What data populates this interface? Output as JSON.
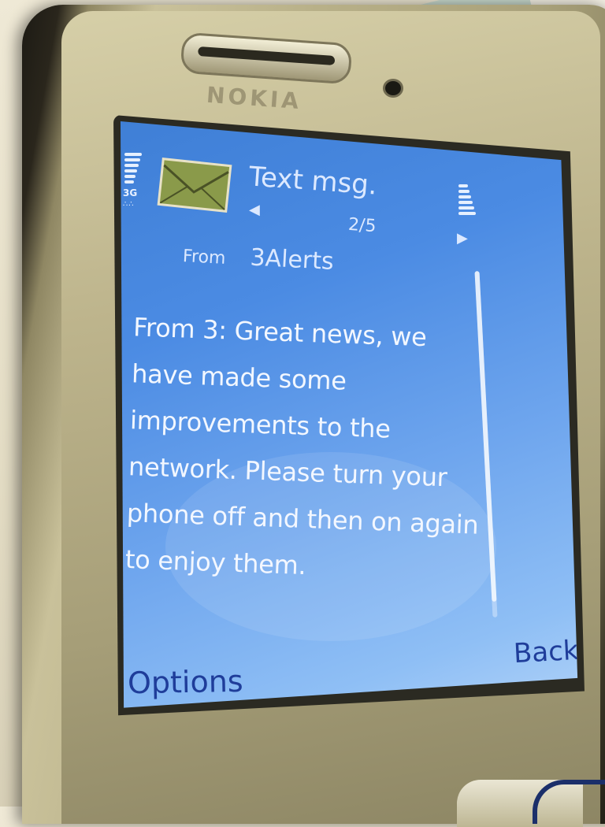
{
  "header": {
    "title": "Text msg.",
    "counter": "2/5",
    "network": "3G",
    "net_dots": "∴∴",
    "nav_prev_icon": "arrow-left",
    "nav_next_icon": "arrow-right"
  },
  "message": {
    "from_label": "From",
    "from_value": "3Alerts",
    "body": "From 3: Great news, we have made some improvements to the network. Please turn your phone off and then on again to enjoy them."
  },
  "softkeys": {
    "left": "Options",
    "right": "Back"
  },
  "device": {
    "brand": "NOKIA"
  },
  "colors": {
    "screen_blue": "#4b8be3",
    "softkey_text": "#1f3d9a",
    "envelope_green": "#8a9a4a"
  },
  "icons": {
    "message": "envelope-icon",
    "signal": "signal-strength-icon",
    "battery": "battery-level-icon"
  }
}
